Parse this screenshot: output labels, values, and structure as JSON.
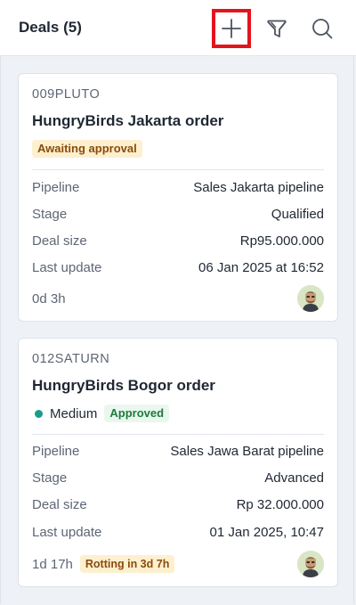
{
  "header": {
    "title": "Deals (5)",
    "add_icon": "plus-icon",
    "filter_icon": "filter-icon",
    "search_icon": "search-icon"
  },
  "deals": [
    {
      "code": "009PLUTO",
      "name": "HungryBirds Jakarta order",
      "status_badge": "Awaiting approval",
      "fields": [
        {
          "label": "Pipeline",
          "value": "Sales Jakarta pipeline"
        },
        {
          "label": "Stage",
          "value": "Qualified"
        },
        {
          "label": "Deal size",
          "value": "Rp95.000.000"
        },
        {
          "label": "Last update",
          "value": "06 Jan 2025 at 16:52"
        }
      ],
      "age": "0d 3h"
    },
    {
      "code": "012SATURN",
      "name": "HungryBirds Bogor order",
      "priority": "Medium",
      "status_badge": "Approved",
      "fields": [
        {
          "label": "Pipeline",
          "value": "Sales Jawa Barat pipeline"
        },
        {
          "label": "Stage",
          "value": "Advanced"
        },
        {
          "label": "Deal size",
          "value": "Rp 32.000.000"
        },
        {
          "label": "Last update",
          "value": "01 Jan 2025, 10:47"
        }
      ],
      "age": "1d 17h",
      "rotting_badge": "Rotting in 3d 7h"
    }
  ],
  "colors": {
    "add_highlight": "#e3141c",
    "priority_medium": "#1a9b8c",
    "awaiting_badge_bg": "#fdf0cf",
    "approved_badge_bg": "#eaf7ee"
  }
}
